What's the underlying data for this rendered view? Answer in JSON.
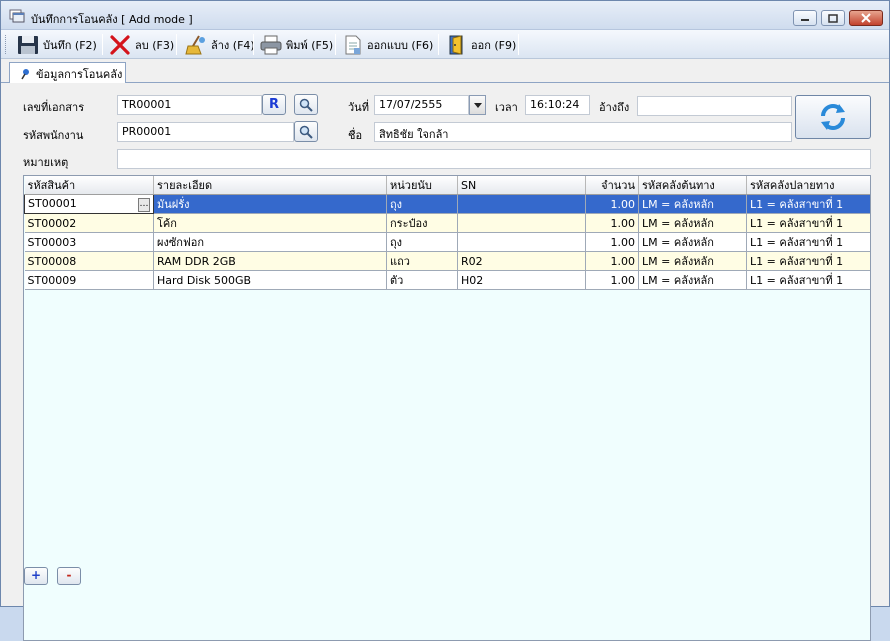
{
  "window": {
    "title": "บันทึกการโอนคลัง [ Add mode ]"
  },
  "toolbar": {
    "save_label": "บันทึก (F2)",
    "delete_label": "ลบ (F3)",
    "clear_label": "ล้าง (F4)",
    "print_label": "พิมพ์ (F5)",
    "design_label": "ออกแบบ (F6)",
    "exit_label": "ออก (F9)"
  },
  "tabs": [
    {
      "label": "ข้อมูลการโอนคลัง"
    }
  ],
  "form": {
    "doc_no_label": "เลขที่เอกสาร",
    "doc_no_value": "TR00001",
    "r_button_label": "R",
    "employee_label": "รหัสพนักงาน",
    "employee_value": "PR00001",
    "date_label": "วันที่",
    "date_value": "17/07/2555",
    "time_label": "เวลา",
    "time_value": "16:10:24",
    "ref_label": "อ้างถึง",
    "ref_value": "",
    "name_label": "ชื่อ",
    "name_value": "สิทธิชัย ใจกล้า",
    "remark_label": "หมายเหตุ",
    "remark_value": ""
  },
  "table": {
    "columns": [
      "รหัสสินค้า",
      "รายละเอียด",
      "หน่วยนับ",
      "SN",
      "จำนวน",
      "รหัสคลังต้นทาง",
      "รหัสคลังปลายทาง"
    ],
    "rows": [
      [
        "ST00001",
        "มันฝรั่ง",
        "ถุง",
        "",
        "1.00",
        "LM = คลังหลัก",
        "L1 = คลังสาขาที่ 1"
      ],
      [
        "ST00002",
        "โค้ก",
        "กระป๋อง",
        "",
        "1.00",
        "LM = คลังหลัก",
        "L1 = คลังสาขาที่ 1"
      ],
      [
        "ST00003",
        "ผงซักฟอก",
        "ถุง",
        "",
        "1.00",
        "LM = คลังหลัก",
        "L1 = คลังสาขาที่ 1"
      ],
      [
        "ST00008",
        "RAM DDR 2GB",
        "แถว",
        "R02",
        "1.00",
        "LM = คลังหลัก",
        "L1 = คลังสาขาที่ 1"
      ],
      [
        "ST00009",
        "Hard Disk 500GB",
        "ตัว",
        "H02",
        "1.00",
        "LM = คลังหลัก",
        "L1 = คลังสาขาที่ 1"
      ]
    ],
    "selected_row": 0,
    "ellipsis_label": "…"
  },
  "footer": {
    "add_label": "+",
    "remove_label": "-"
  },
  "colors": {
    "selected_row": "#3569cc",
    "alt_row": "#fffde4",
    "grid_bg": "#f0fefe"
  },
  "icons": {
    "app": "window-stack-icon",
    "save": "floppy-disk-icon",
    "delete": "red-x-icon",
    "clear": "broom-icon",
    "print": "printer-icon",
    "design": "document-design-icon",
    "exit": "exit-door-icon",
    "tab": "pin-icon",
    "lookup": "magnifier-icon",
    "refresh": "refresh-arrows-icon"
  }
}
